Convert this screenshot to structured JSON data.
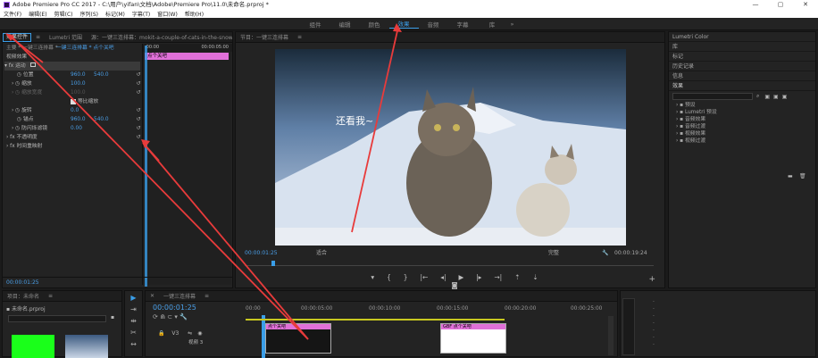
{
  "titlebar": {
    "title": "Adobe Premiere Pro CC 2017 - C:\\用户\\yifan\\文档\\Adobe\\Premiere Pro\\11.0\\未命名.prproj *"
  },
  "menu": [
    "文件(F)",
    "编辑(E)",
    "剪辑(C)",
    "序列(S)",
    "标记(M)",
    "字幕(T)",
    "窗口(W)",
    "帮助(H)"
  ],
  "workspaces": [
    "组件",
    "编辑",
    "颜色",
    "效果",
    "音频",
    "字幕",
    "库"
  ],
  "effect_controls": {
    "tabs": [
      "效果控件",
      "Lumetri 范围",
      "源：一键三连排幕：mokit-a-couple-of-cats-in-the-snow-9t"
    ],
    "master_label": "主要 * 一键三连排幕 *",
    "clip_label": "一键三连排幕 * 点个关吧",
    "clip_timecode_start": ":00:00",
    "clip_timecode_end": "00:00:05:00",
    "clip_bar_label": "点个关吧",
    "section_video": "视频效果",
    "motion": "fx 运动",
    "position": {
      "label": "位置",
      "x": "960.0",
      "y": "540.0"
    },
    "scale": {
      "label": "缩放",
      "value": "100.0"
    },
    "scale_width": {
      "label": "缩放宽度",
      "value": "100.0"
    },
    "uniform_scale": "等比缩放",
    "rotation": {
      "label": "旋转",
      "value": "0.0"
    },
    "anchor": {
      "label": "锚点",
      "x": "960.0",
      "y": "540.0"
    },
    "antiflicker": {
      "label": "防闪烁滤镜",
      "value": "0.00"
    },
    "opacity": "fx 不透明度",
    "time_remap": "fx 时间重映射",
    "footer_timecode": "00:00:01:25"
  },
  "program": {
    "tab": "节目：一键三连排幕",
    "overlay_text": "还看我~",
    "timecode_left": "00:00:01:25",
    "fit": "适合",
    "quality": "完整",
    "timecode_right": "00:00:19:24"
  },
  "right_panels": {
    "items": [
      "Lumetri Color",
      "库",
      "标记",
      "历史记录",
      "信息"
    ],
    "effects_title": "效果",
    "effects_tree": [
      "预设",
      "Lumetri 预设",
      "音频效果",
      "音频过渡",
      "视频效果",
      "视频过渡"
    ]
  },
  "project": {
    "tab": "项目：未命名",
    "file": "未命名.prproj"
  },
  "timeline": {
    "tab": "一键三连排幕",
    "timecode": "00:00:01:25",
    "ruler": [
      "00:00",
      "00:00:05:00",
      "00:00:10:00",
      "00:00:15:00",
      "00:00:20:00",
      "00:00:25:00"
    ],
    "track_v3": "V3",
    "track_name": "视频 3",
    "clip1_label": "点个关吧",
    "clip2_label": "GBF 点个关吧"
  }
}
